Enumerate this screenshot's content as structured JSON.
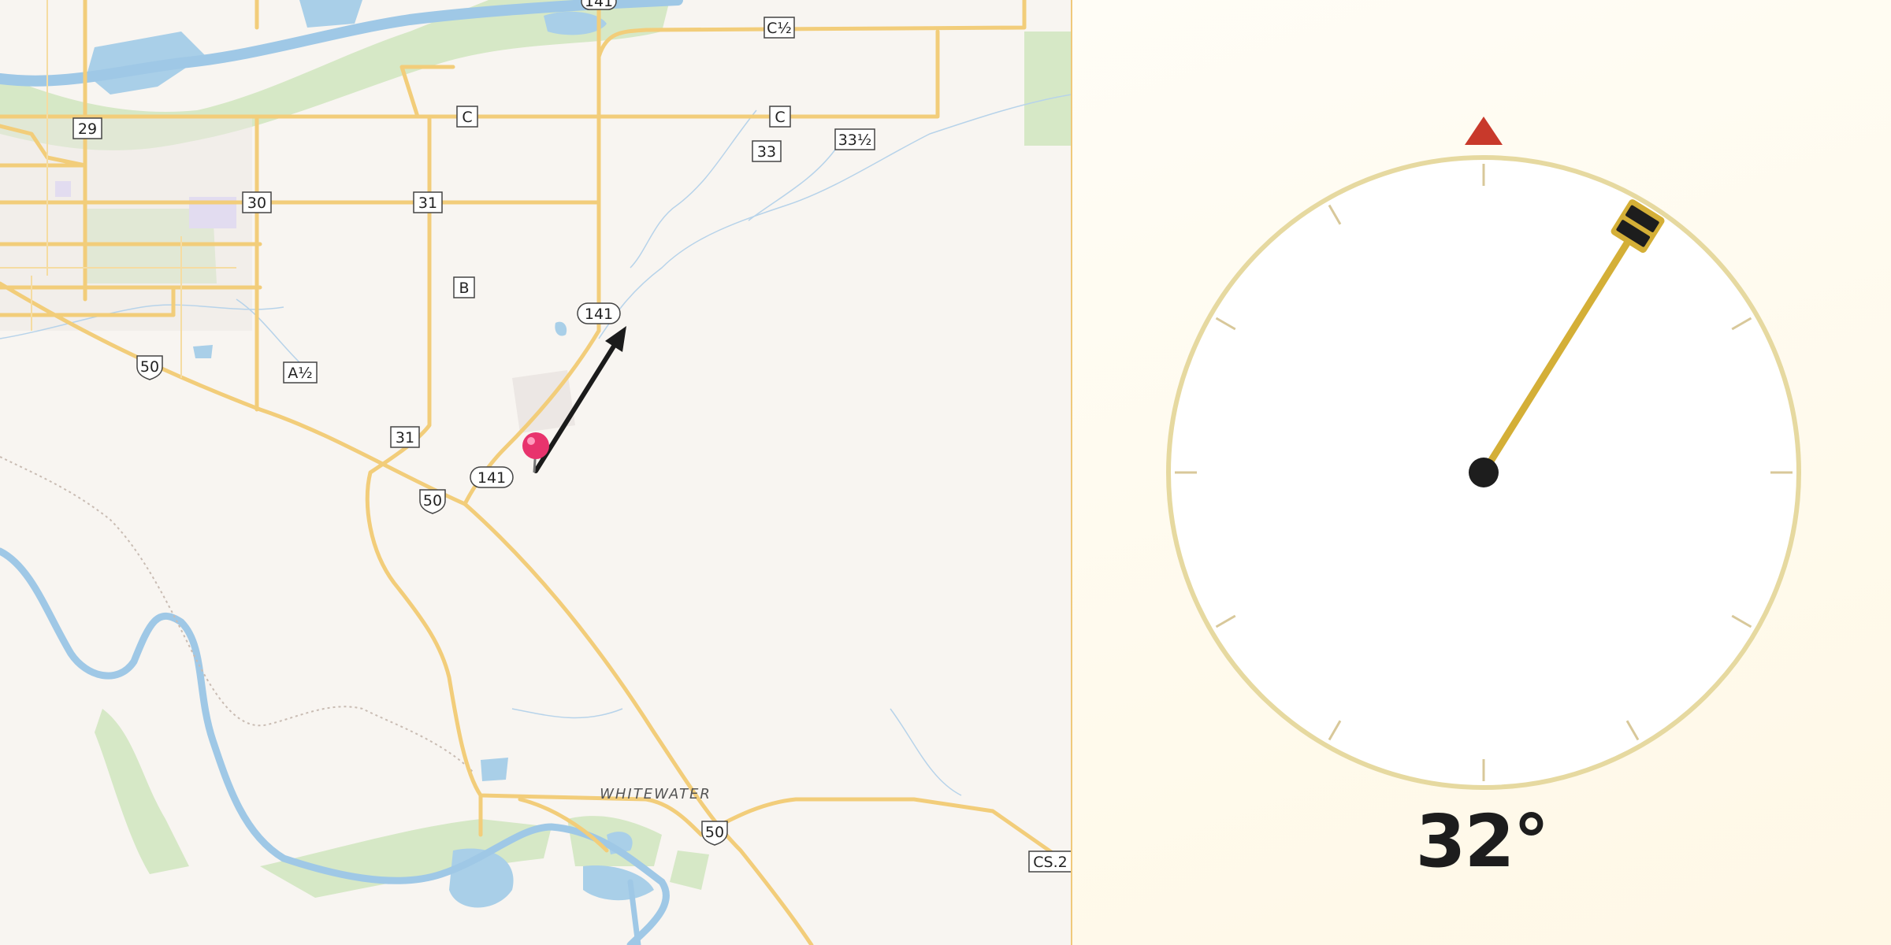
{
  "map": {
    "place_labels": [
      {
        "name": "whitewater-label",
        "text": "WHITEWATER"
      }
    ],
    "road_labels": [
      {
        "name": "road-label-141-top",
        "text": "141",
        "kind": "oval"
      },
      {
        "name": "road-label-c-half",
        "text": "C½",
        "kind": "box"
      },
      {
        "name": "road-label-c-left",
        "text": "C",
        "kind": "box"
      },
      {
        "name": "road-label-c-right",
        "text": "C",
        "kind": "box"
      },
      {
        "name": "road-label-29",
        "text": "29",
        "kind": "box"
      },
      {
        "name": "road-label-33",
        "text": "33",
        "kind": "box"
      },
      {
        "name": "road-label-33-half",
        "text": "33½",
        "kind": "box"
      },
      {
        "name": "road-label-30",
        "text": "30",
        "kind": "box"
      },
      {
        "name": "road-label-31-top",
        "text": "31",
        "kind": "box"
      },
      {
        "name": "road-label-b",
        "text": "B",
        "kind": "box"
      },
      {
        "name": "road-label-141-mid",
        "text": "141",
        "kind": "oval"
      },
      {
        "name": "road-label-us50-west",
        "text": "50",
        "kind": "us"
      },
      {
        "name": "road-label-a-half",
        "text": "A½",
        "kind": "box"
      },
      {
        "name": "road-label-31-low",
        "text": "31",
        "kind": "box"
      },
      {
        "name": "road-label-141-low",
        "text": "141",
        "kind": "oval"
      },
      {
        "name": "road-label-us50-mid",
        "text": "50",
        "kind": "us"
      },
      {
        "name": "road-label-us50-east",
        "text": "50",
        "kind": "us"
      },
      {
        "name": "road-label-cs2",
        "text": "CS.2",
        "kind": "box"
      }
    ],
    "pin_color": "#e8336d",
    "arrow_color": "#1b1b1b"
  },
  "compass": {
    "heading_degrees": 32,
    "heading_text": "32°",
    "north_marker_color": "#c8392b",
    "needle_color": "#d4af37",
    "ring_color": "#e6d9a0"
  }
}
